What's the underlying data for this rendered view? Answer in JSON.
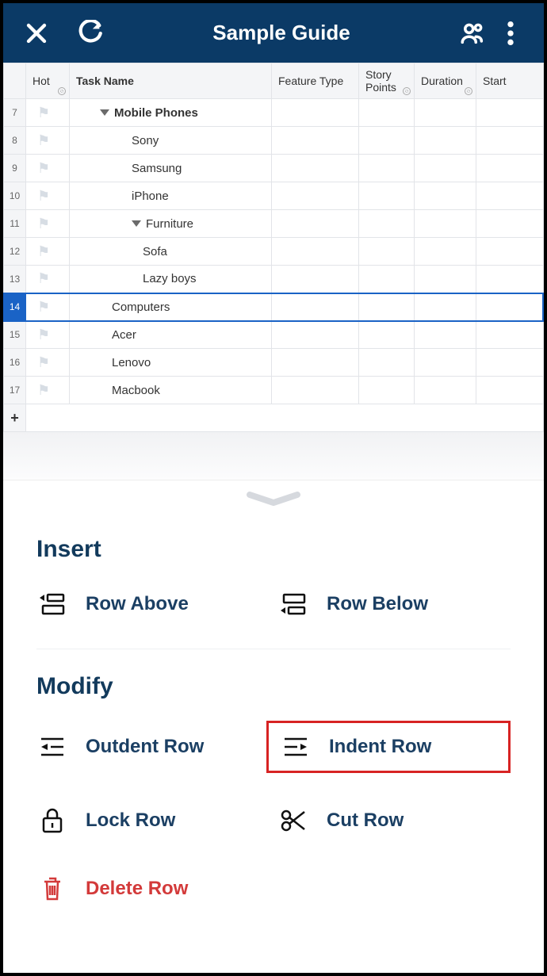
{
  "header": {
    "title": "Sample Guide"
  },
  "columns": {
    "hot": "Hot",
    "task": "Task Name",
    "feature": "Feature Type",
    "points": "Story Points",
    "duration": "Duration",
    "start": "Start"
  },
  "rows": [
    {
      "n": "7",
      "name": "Mobile Phones",
      "indent": "ind0",
      "bold": true,
      "caret": true,
      "selected": false
    },
    {
      "n": "8",
      "name": "Sony",
      "indent": "ind1",
      "bold": false,
      "caret": false,
      "selected": false
    },
    {
      "n": "9",
      "name": "Samsung",
      "indent": "ind1",
      "bold": false,
      "caret": false,
      "selected": false
    },
    {
      "n": "10",
      "name": "iPhone",
      "indent": "ind1",
      "bold": false,
      "caret": false,
      "selected": false
    },
    {
      "n": "11",
      "name": "Furniture",
      "indent": "ind1",
      "bold": false,
      "caret": true,
      "selected": false
    },
    {
      "n": "12",
      "name": "Sofa",
      "indent": "ind2",
      "bold": false,
      "caret": false,
      "selected": false
    },
    {
      "n": "13",
      "name": "Lazy boys",
      "indent": "ind2",
      "bold": false,
      "caret": false,
      "selected": false
    },
    {
      "n": "14",
      "name": "Computers",
      "indent": "indC",
      "bold": false,
      "caret": false,
      "selected": true
    },
    {
      "n": "15",
      "name": "Acer",
      "indent": "indC",
      "bold": false,
      "caret": false,
      "selected": false
    },
    {
      "n": "16",
      "name": "Lenovo",
      "indent": "indC",
      "bold": false,
      "caret": false,
      "selected": false
    },
    {
      "n": "17",
      "name": "Macbook",
      "indent": "indC",
      "bold": false,
      "caret": false,
      "selected": false
    }
  ],
  "addrow_symbol": "+",
  "panel": {
    "insert_title": "Insert",
    "modify_title": "Modify",
    "row_above": "Row Above",
    "row_below": "Row Below",
    "outdent": "Outdent Row",
    "indent": "Indent Row",
    "lock": "Lock Row",
    "cut": "Cut Row",
    "delete": "Delete Row",
    "highlighted": "indent"
  }
}
